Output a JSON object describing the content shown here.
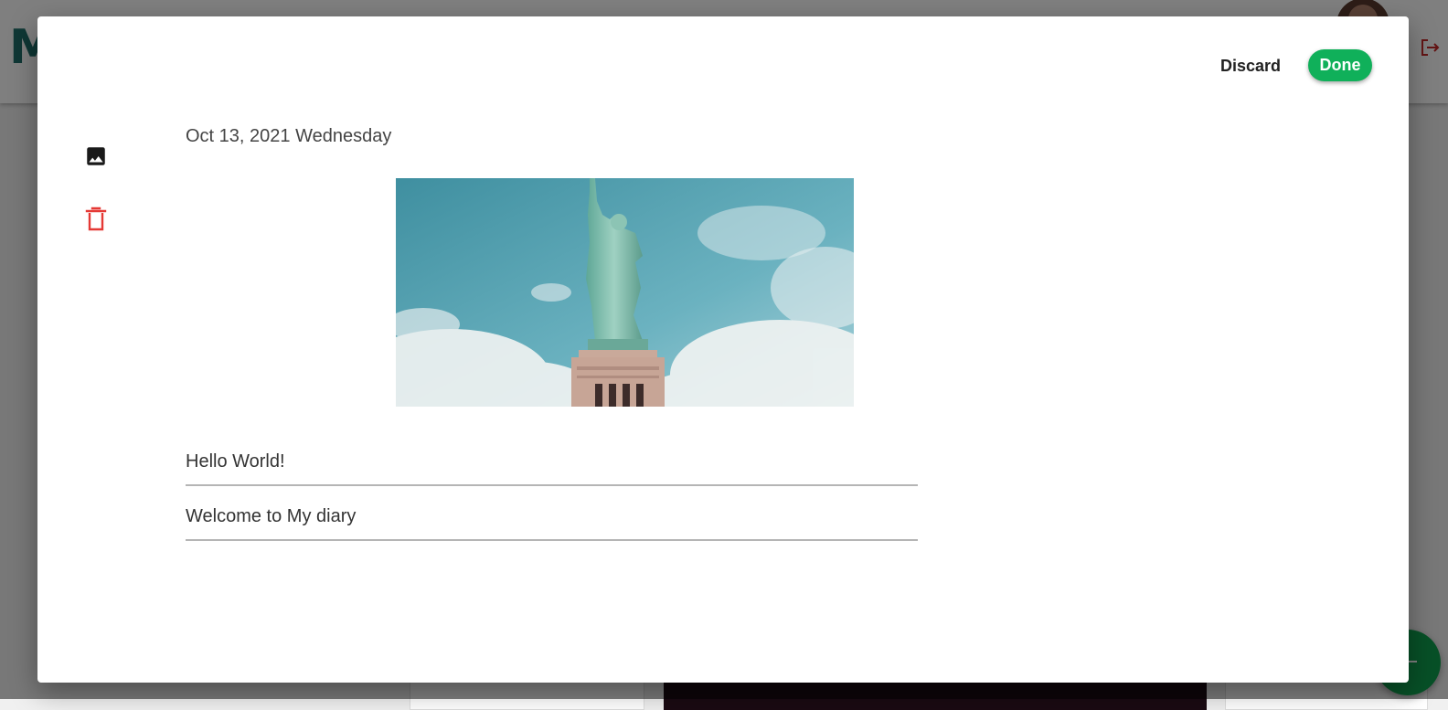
{
  "app": {
    "brand_letter": "M"
  },
  "modal": {
    "discard_label": "Discard",
    "done_label": "Done",
    "date": "Oct 13, 2021 Wednesday",
    "title_value": "Hello World!",
    "body_value": "Welcome to My diary"
  },
  "sidebar": {
    "icons": [
      "image-icon",
      "trash-icon"
    ]
  },
  "colors": {
    "accent": "#10b05a",
    "danger": "#e53935",
    "brand": "#1f6f6a"
  }
}
